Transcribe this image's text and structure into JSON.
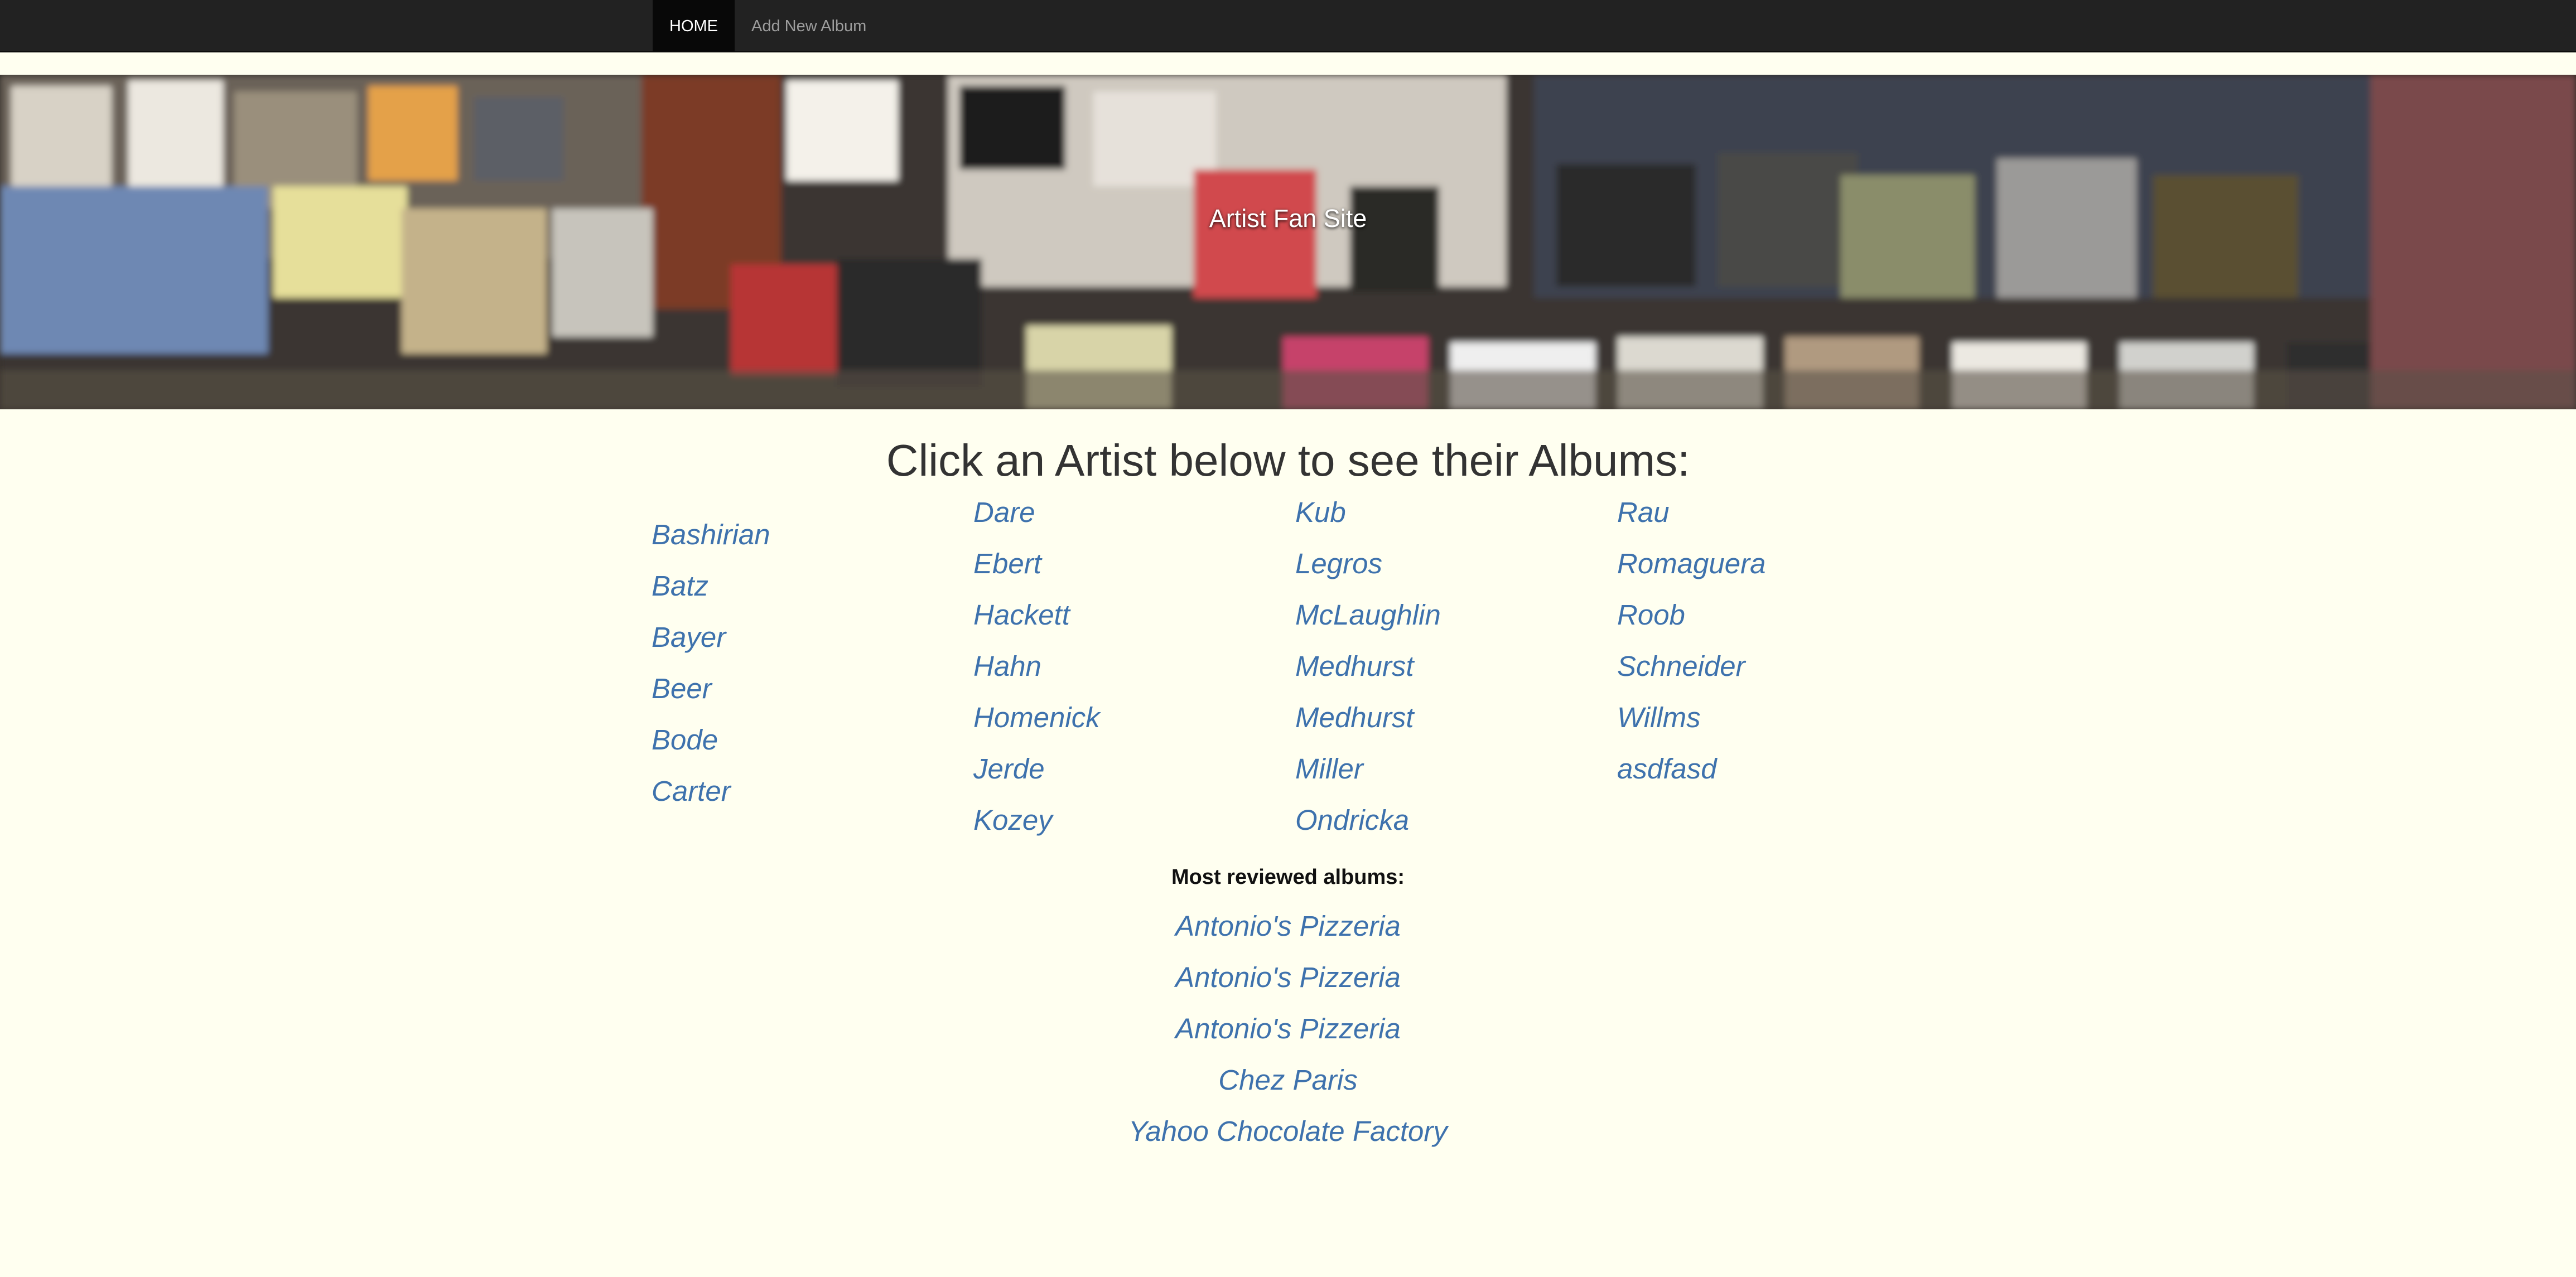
{
  "navbar": {
    "items": [
      {
        "label": "HOME",
        "active": true
      },
      {
        "label": "Add New Album",
        "active": false
      }
    ]
  },
  "hero": {
    "title": "Artist Fan Site"
  },
  "main": {
    "heading": "Click an Artist below to see their Albums:",
    "artist_columns": [
      [
        "Bashirian",
        "Batz",
        "Bayer",
        "Beer",
        "Bode",
        "Carter"
      ],
      [
        "Dare",
        "Ebert",
        "Hackett",
        "Hahn",
        "Homenick",
        "Jerde",
        "Kozey"
      ],
      [
        "Kub",
        "Legros",
        "McLaughlin",
        "Medhurst",
        "Medhurst",
        "Miller",
        "Ondricka"
      ],
      [
        "Rau",
        "Romaguera",
        "Roob",
        "Schneider",
        "Willms",
        "asdfasd"
      ]
    ],
    "most_reviewed_label": "Most reviewed albums:",
    "most_reviewed": [
      "Antonio's Pizzeria",
      "Antonio's Pizzeria",
      "Antonio's Pizzeria",
      "Chez Paris",
      "Yahoo Chocolate Factory"
    ]
  },
  "colors": {
    "navbar_bg": "#222222",
    "page_bg": "#fffff0",
    "link": "#3e72ad",
    "heading": "#333333"
  }
}
